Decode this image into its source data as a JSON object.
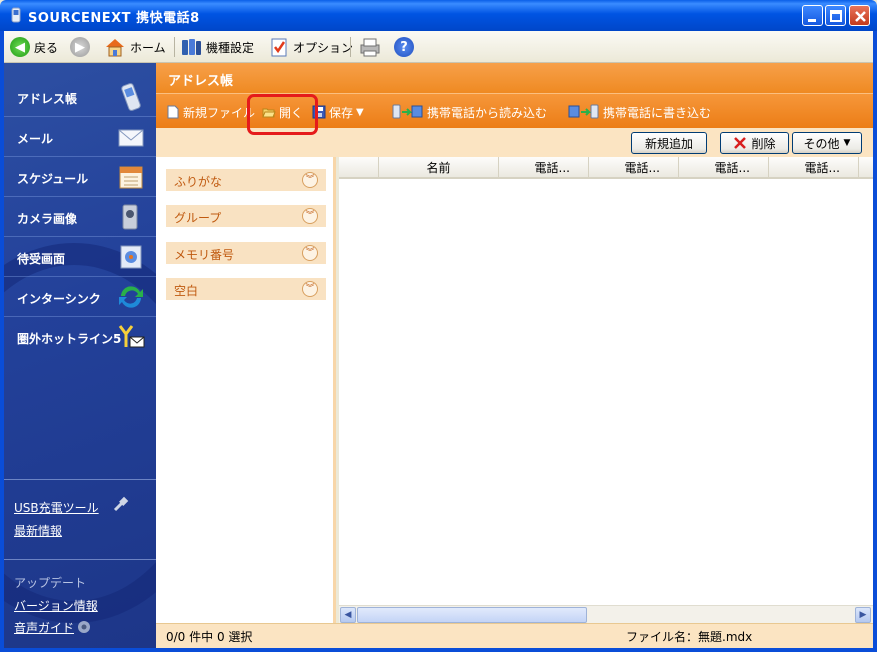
{
  "window": {
    "title": "SOURCENEXT 携快電話8"
  },
  "toolbar": {
    "back": "戻る",
    "home": "ホーム",
    "model_settings": "機種設定",
    "options": "オプション"
  },
  "sidebar": {
    "items": [
      {
        "label": "アドレス帳",
        "icon": "phone-icon"
      },
      {
        "label": "メール",
        "icon": "envelope-icon"
      },
      {
        "label": "スケジュール",
        "icon": "calendar-icon"
      },
      {
        "label": "カメラ画像",
        "icon": "camera-icon"
      },
      {
        "label": "待受画面",
        "icon": "wallpaper-icon"
      },
      {
        "label": "インターシンク",
        "icon": "sync-icon"
      },
      {
        "label": "圏外ホットライン5",
        "icon": "antenna-mail-icon"
      }
    ],
    "links": {
      "usb_charge": "USB充電ツール",
      "latest_info": "最新情報",
      "update_heading": "アップデート",
      "version_info": "バージョン情報",
      "voice_guide": "音声ガイド"
    }
  },
  "main": {
    "title": "アドレス帳",
    "actions": {
      "new_file": "新規ファイル",
      "open": "開く",
      "save": "保存",
      "read_from_phone": "携帯電話から読み込む",
      "write_to_phone": "携帯電話に書き込む"
    },
    "buttons": {
      "add_new": "新規追加",
      "delete": "削除",
      "other": "その他"
    },
    "filters": [
      "ふりがな",
      "グループ",
      "メモリ番号",
      "空白"
    ],
    "table": {
      "columns": [
        "名前",
        "電話...",
        "電話...",
        "電話...",
        "電話..."
      ]
    },
    "status": {
      "selection": "0/0 件中 0 選択",
      "filename": "ファイル名：無題.mdx"
    }
  },
  "colors": {
    "titlebar": "#0054e3",
    "sidebar": "#23419a",
    "accent_orange": "#ef8a22",
    "highlight_red": "#e51b1b"
  }
}
